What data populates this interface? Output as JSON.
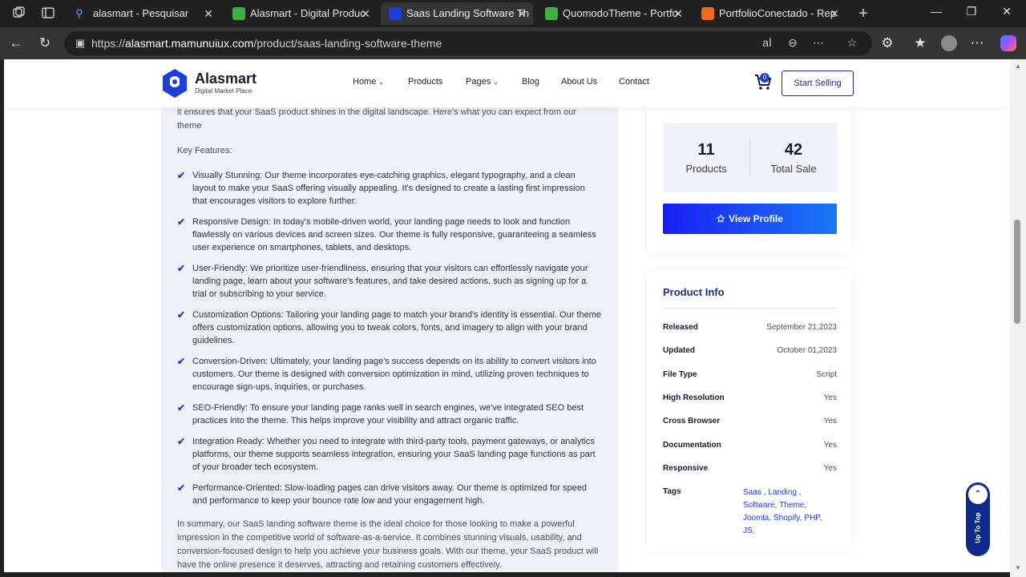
{
  "browser": {
    "tabs": [
      {
        "title": "alasmart - Pesquisar",
        "favicon_color": "#2b6cff",
        "active": false
      },
      {
        "title": "Alasmart - Digital Produc",
        "favicon_color": "#3cb043",
        "active": false
      },
      {
        "title": "Saas Landing Software Th",
        "favicon_color": "#1b3ed8",
        "active": true
      },
      {
        "title": "QuomodoTheme - Portfo",
        "favicon_color": "#3cb043",
        "active": false
      },
      {
        "title": "PortfolioConectado - Rep",
        "favicon_color": "#f06a1a",
        "active": false
      }
    ],
    "url_prefix": "https://",
    "url_host": "alasmart.mamunuiux.com",
    "url_path": "/product/saas-landing-software-theme",
    "icons": [
      "workspaces-icon",
      "tab-actions-icon",
      "back-icon",
      "refresh-icon",
      "read-aloud-icon",
      "zoom-icon",
      "more-tools-icon",
      "favorite-icon",
      "extensions-icon",
      "favorites-icon",
      "profile-icon",
      "settings-icon",
      "copilot-icon"
    ]
  },
  "site": {
    "logo_name": "Alasmart",
    "logo_sub": "Digital Market Place",
    "nav": [
      "Home",
      "Products",
      "Pages",
      "Blog",
      "About Us",
      "Contact"
    ],
    "cart_count": "0",
    "start_selling": "Start Selling",
    "accent": "#1b3ed8"
  },
  "content": {
    "intro_lines": [
      "it ensures that your SaaS product shines in the digital landscape. Here's what you can expect from our",
      "theme"
    ],
    "key_features_label": "Key Features:",
    "features": [
      "Visually Stunning: Our theme incorporates eye-catching graphics, elegant typography, and a clean layout to make your SaaS offering visually appealing. It's designed to create a lasting first impression that encourages visitors to explore further.",
      "Responsive Design: In today's mobile-driven world, your landing page needs to look and function flawlessly on various devices and screen sizes. Our theme is fully responsive, guaranteeing a seamless user experience on smartphones, tablets, and desktops.",
      "User-Friendly: We prioritize user-friendliness, ensuring that your visitors can effortlessly navigate your landing page, learn about your software's features, and take desired actions, such as signing up for a trial or subscribing to your service.",
      "Customization Options: Tailoring your landing page to match your brand's identity is essential. Our theme offers customization options, allowing you to tweak colors, fonts, and imagery to align with your brand guidelines.",
      "Conversion-Driven: Ultimately, your landing page's success depends on its ability to convert visitors into customers. Our theme is designed with conversion optimization in mind, utilizing proven techniques to encourage sign-ups, inquiries, or purchases.",
      "SEO-Friendly: To ensure your landing page ranks well in search engines, we've integrated SEO best practices into the theme. This helps improve your visibility and attract organic traffic.",
      "Integration Ready: Whether you need to integrate with third-party tools, payment gateways, or analytics platforms, our theme supports seamless integration, ensuring your SaaS landing page functions as part of your broader tech ecosystem.",
      "Performance-Oriented: Slow-loading pages can drive visitors away. Our theme is optimized for speed and performance to keep your bounce rate low and your engagement high."
    ],
    "summary": "In summary, our SaaS landing software theme is the ideal choice for those looking to make a powerful impression in the competitive world of software-as-a-service. It combines stunning visuals, usability, and conversion-focused design to help you achieve your business goals. With our theme, your SaaS product will have the online presence it deserves, attracting and retaining customers effectively."
  },
  "author": {
    "products_count": "11",
    "products_label": "Products",
    "total_sale_count": "42",
    "total_sale_label": "Total Sale",
    "view_profile": "View Profile"
  },
  "product_info": {
    "title": "Product Info",
    "rows": [
      {
        "key": "Released",
        "value": "September 21,2023"
      },
      {
        "key": "Updated",
        "value": "October 01,2023"
      },
      {
        "key": "File Type",
        "value": "Script"
      },
      {
        "key": "High Resolution",
        "value": "Yes"
      },
      {
        "key": "Cross Browser",
        "value": "Yes"
      },
      {
        "key": "Documentation",
        "value": "Yes"
      },
      {
        "key": "Responsive",
        "value": "Yes"
      }
    ],
    "tags_label": "Tags",
    "tags": [
      "Saas ,",
      "Landing ,",
      "Software,",
      "Theme,",
      "Joomla,",
      "Shopify,",
      "PHP,",
      "JS,"
    ]
  },
  "up_to_top": "Up To Top"
}
